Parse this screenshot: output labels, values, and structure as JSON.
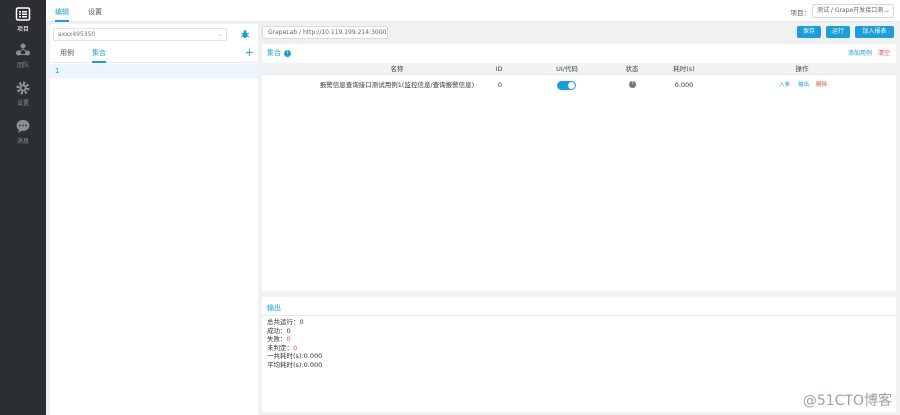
{
  "sidebar": {
    "items": [
      {
        "label": "项目",
        "icon": "project-list-icon",
        "active": true
      },
      {
        "label": "团队",
        "icon": "team-icon",
        "active": false
      },
      {
        "label": "设置",
        "icon": "gear-icon",
        "active": false
      },
      {
        "label": "消息",
        "icon": "chat-bubble-icon",
        "active": false
      }
    ]
  },
  "topbar": {
    "tabs": [
      {
        "label": "编辑"
      },
      {
        "label": "设置"
      }
    ],
    "project_label": "项目：",
    "project_value": "测试 / Grape开发接口测..."
  },
  "left_panel": {
    "case_select_value": "axxx495350",
    "tabs": [
      {
        "label": "用例"
      },
      {
        "label": "集合"
      }
    ],
    "plus": "+",
    "list_items": [
      "1"
    ]
  },
  "env_select": {
    "value": "GrapeLab / http://10.119.199.214:3000"
  },
  "buttons": {
    "save": "保存",
    "run": "运行",
    "add_report": "加入报表"
  },
  "collection": {
    "title": "集合",
    "info": "i",
    "add_case": "添加用例",
    "clear": "清空",
    "columns": [
      "名称",
      "ID",
      "UI/代码",
      "状态",
      "耗时(s)",
      "操作"
    ],
    "rows": [
      {
        "name": "报警信息查询接口测试用例1(监控信息/查询报警信息)",
        "id": "0",
        "ui_code_enabled": true,
        "status_icon": "!",
        "time": "0.000",
        "ops": [
          "入参",
          "输出",
          "删除"
        ]
      }
    ]
  },
  "output": {
    "title": "输出",
    "lines": [
      {
        "label": "总共运行：",
        "value": "0",
        "highlight": false
      },
      {
        "label": "成功：",
        "value": "0",
        "highlight": false
      },
      {
        "label": "失败：",
        "value": "0",
        "highlight": true
      },
      {
        "label": "未判定：",
        "value": "0",
        "highlight": true
      },
      {
        "label": "一共耗时(s):",
        "value": "0.000",
        "highlight": false
      },
      {
        "label": "平均耗时(s):",
        "value": "0.000",
        "highlight": false
      }
    ]
  },
  "watermark": "@51CTO博客",
  "colors": {
    "accent": "#1a9fd8",
    "danger": "#e54b4b",
    "sidebar_bg": "#2b2f33"
  }
}
